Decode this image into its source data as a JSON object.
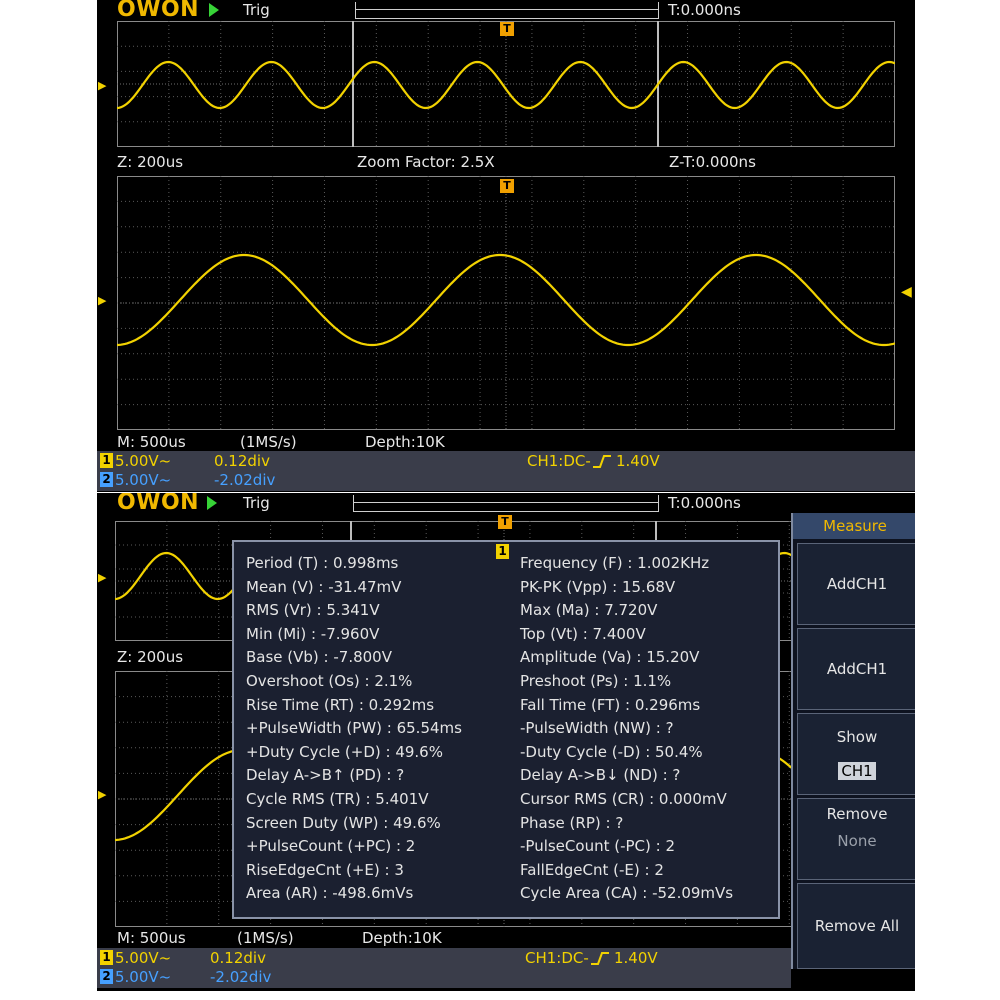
{
  "top": {
    "logo": "OWON",
    "trig": "Trig",
    "time_offset": "T:0.000ns",
    "zoom_label": "Z: 200us",
    "zoom_factor": "Zoom Factor: 2.5X",
    "zoom_time": "Z-T:0.000ns",
    "timebase": "M: 500us",
    "sample_rate": "(1MS/s)",
    "depth": "Depth:10K",
    "ch1_scale": "5.00V~",
    "ch1_offset": "0.12div",
    "ch2_scale": "5.00V~",
    "ch2_offset": "-2.02div",
    "trigger_info": "CH1:DC-",
    "trigger_level": "1.40V"
  },
  "bottom": {
    "logo": "OWON",
    "trig": "Trig",
    "time_offset": "T:0.000ns",
    "zoom_label": "Z: 200us",
    "timebase": "M: 500us",
    "sample_rate": "(1MS/s)",
    "depth": "Depth:10K",
    "ch1_scale": "5.00V~",
    "ch1_offset": "0.12div",
    "ch2_scale": "5.00V~",
    "ch2_offset": "-2.02div",
    "trigger_info": "CH1:DC-",
    "trigger_level": "1.40V"
  },
  "measurements": {
    "left": [
      "Period (T) : 0.998ms",
      "Mean (V) : -31.47mV",
      "RMS (Vr) : 5.341V",
      "Min (Mi) : -7.960V",
      "Base (Vb) : -7.800V",
      "Overshoot (Os) : 2.1%",
      "Rise Time (RT) : 0.292ms",
      "+PulseWidth (PW) : 65.54ms",
      "+Duty Cycle (+D) : 49.6%",
      "Delay A->B↑ (PD) :   ?",
      "Cycle RMS (TR) : 5.401V",
      "Screen Duty (WP) : 49.6%",
      "+PulseCount (+PC) : 2",
      "RiseEdgeCnt (+E) : 3",
      "Area (AR) : -498.6mVs"
    ],
    "right": [
      "Frequency (F) : 1.002KHz",
      "PK-PK (Vpp) : 15.68V",
      "Max (Ma) : 7.720V",
      "Top (Vt) : 7.400V",
      "Amplitude (Va) : 15.20V",
      "Preshoot (Ps) : 1.1%",
      "Fall Time (FT) : 0.296ms",
      "-PulseWidth (NW) :   ?",
      "-Duty Cycle (-D) : 50.4%",
      "Delay A->B↓ (ND) :   ?",
      "Cursor RMS (CR) : 0.000mV",
      "Phase (RP) :   ?",
      "-PulseCount (-PC) : 2",
      "FallEdgeCnt (-E) : 2",
      "Cycle Area (CA) : -52.09mVs"
    ]
  },
  "menu": {
    "title": "Measure",
    "btn1": "AddCH1",
    "btn2": "AddCH1",
    "show_label": "Show",
    "show_value": "CH1",
    "remove_label": "Remove",
    "remove_value": "None",
    "remove_all": "Remove All"
  },
  "channel_badges": {
    "ch1": "1",
    "ch2": "2",
    "trigger_marker": "T",
    "ch_marker": "1"
  },
  "colors": {
    "ch1": "#f2d200",
    "ch2": "#46a0ff",
    "background": "#000000",
    "grid": "#5a5a5a"
  }
}
